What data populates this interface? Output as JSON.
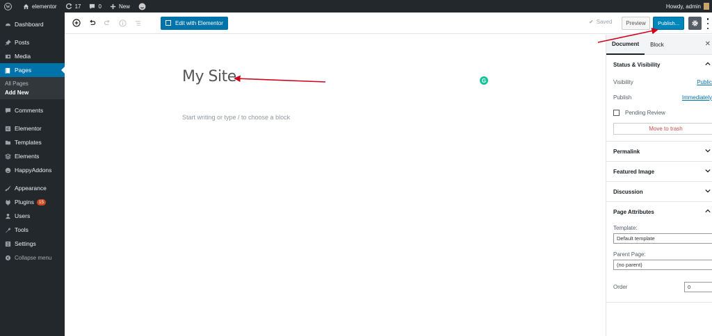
{
  "adminbar": {
    "site_name": "elementor",
    "updates_count": "17",
    "comments_count": "0",
    "new_label": "New",
    "greeting": "Howdy, admin"
  },
  "sidebar": {
    "items": [
      {
        "label": "Dashboard",
        "icon": "dashboard-icon"
      },
      {
        "label": "Posts",
        "icon": "pin-icon"
      },
      {
        "label": "Media",
        "icon": "media-icon"
      },
      {
        "label": "Pages",
        "icon": "pages-icon"
      },
      {
        "label": "Comments",
        "icon": "comments-icon"
      },
      {
        "label": "Elementor",
        "icon": "elementor-icon"
      },
      {
        "label": "Templates",
        "icon": "folder-icon"
      },
      {
        "label": "Elements",
        "icon": "elements-icon"
      },
      {
        "label": "HappyAddons",
        "icon": "happyaddons-icon"
      },
      {
        "label": "Appearance",
        "icon": "brush-icon"
      },
      {
        "label": "Plugins",
        "icon": "plugin-icon",
        "badge": "15"
      },
      {
        "label": "Users",
        "icon": "users-icon"
      },
      {
        "label": "Tools",
        "icon": "wrench-icon"
      },
      {
        "label": "Settings",
        "icon": "settings-icon"
      }
    ],
    "submenu": {
      "all_pages": "All Pages",
      "add_new": "Add New"
    },
    "collapse_label": "Collapse menu"
  },
  "toolbar": {
    "elementor_button": "Edit with Elementor",
    "saved_label": "Saved",
    "preview_label": "Preview",
    "publish_label": "Publish..."
  },
  "editor": {
    "title": "My Site",
    "placeholder": "Start writing or type / to choose a block"
  },
  "settings": {
    "tabs": {
      "document": "Document",
      "block": "Block"
    },
    "status": {
      "heading": "Status & Visibility",
      "visibility_label": "Visibility",
      "visibility_value": "Public",
      "publish_label": "Publish",
      "publish_value": "Immediately",
      "pending_review": "Pending Review",
      "trash_button": "Move to trash"
    },
    "permalink": "Permalink",
    "featured_image": "Featured Image",
    "discussion": "Discussion",
    "page_attributes": {
      "heading": "Page Attributes",
      "template_label": "Template:",
      "template_value": "Default template",
      "parent_label": "Parent Page:",
      "parent_value": "(no parent)",
      "order_label": "Order",
      "order_value": "0"
    }
  },
  "colors": {
    "admin_dark": "#23282d",
    "accent_blue": "#0073aa",
    "annotation_red": "#d0021b"
  }
}
